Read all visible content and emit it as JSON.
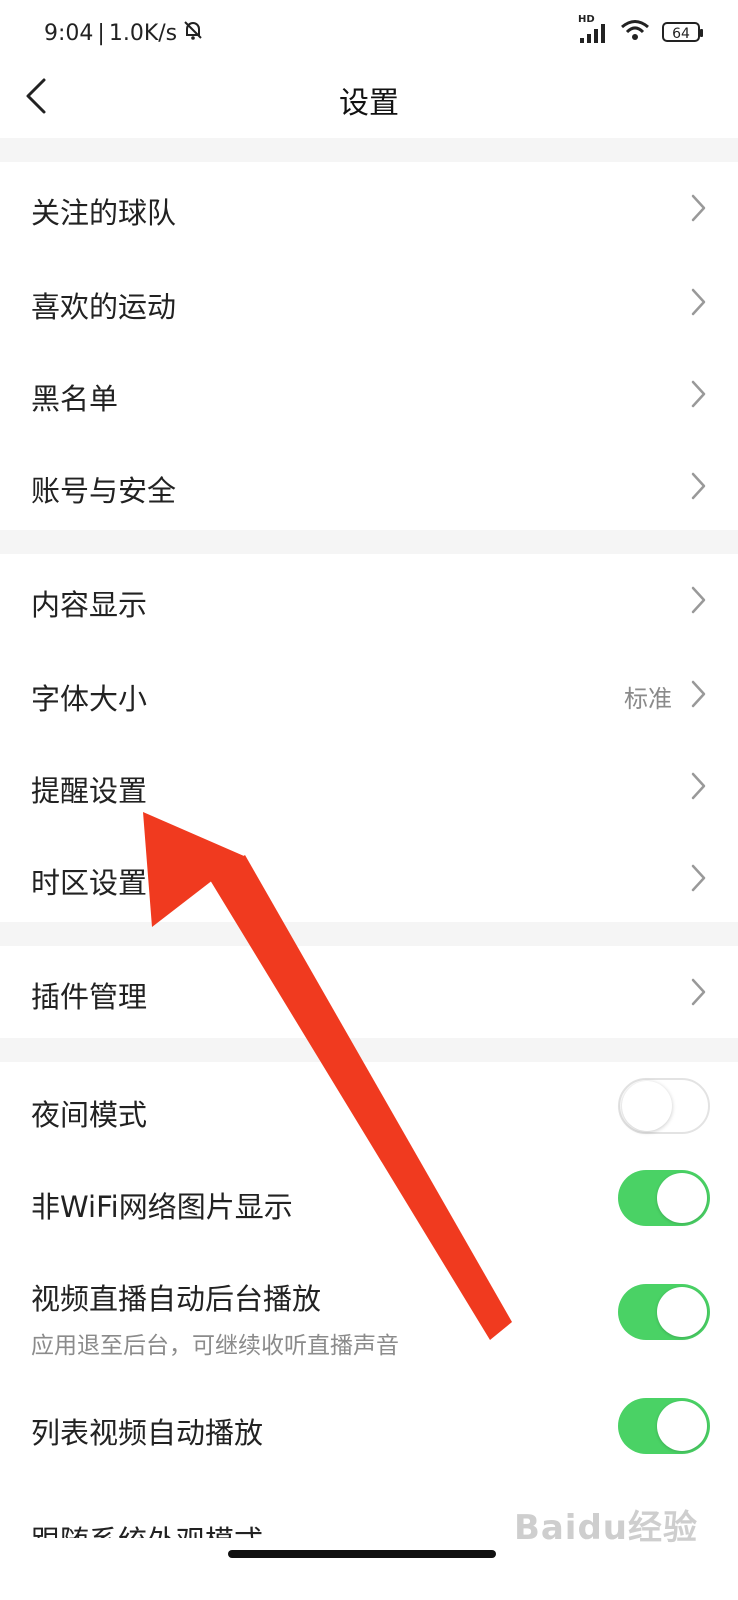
{
  "status_bar": {
    "time": "9:04",
    "speed": "1.0K/s",
    "network": "HD",
    "battery": "64"
  },
  "header": {
    "title": "设置"
  },
  "groups": [
    {
      "items": [
        {
          "label": "关注的球队"
        },
        {
          "label": "喜欢的运动"
        },
        {
          "label": "黑名单"
        },
        {
          "label": "账号与安全"
        }
      ]
    },
    {
      "items": [
        {
          "label": "内容显示"
        },
        {
          "label": "字体大小",
          "value": "标准"
        },
        {
          "label": "提醒设置"
        },
        {
          "label": "时区设置"
        }
      ]
    },
    {
      "items": [
        {
          "label": "插件管理"
        }
      ]
    }
  ],
  "toggles": [
    {
      "label": "夜间模式",
      "on": false
    },
    {
      "label": "非WiFi网络图片显示",
      "on": true
    },
    {
      "label": "视频直播自动后台播放",
      "sublabel": "应用退至后台，可继续收听直播声音",
      "on": true
    },
    {
      "label": "列表视频自动播放",
      "on": true
    }
  ],
  "partial_item": {
    "label": "跟随系统外观模式"
  },
  "watermark": "Baidu经验",
  "colors": {
    "toggle_on": "#4ad265",
    "arrow": "#f03a1f"
  }
}
